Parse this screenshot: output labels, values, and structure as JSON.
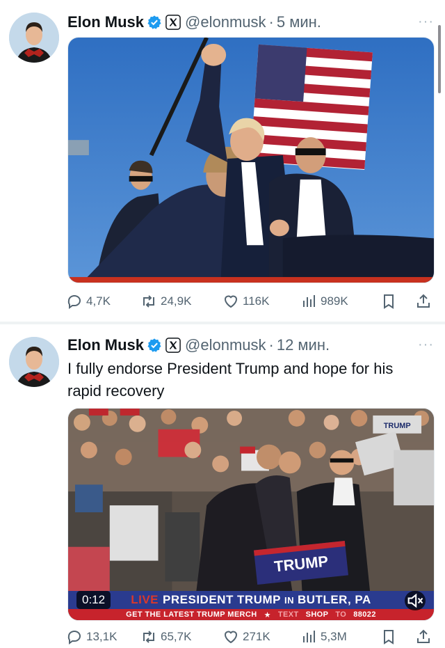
{
  "tweets": [
    {
      "name": "Elon Musk",
      "handle": "@elonmusk",
      "separator": "·",
      "time": "5 мин.",
      "more": "···",
      "text": "",
      "stats": {
        "replies": "4,7K",
        "reposts": "24,9K",
        "likes": "116K",
        "views": "989K"
      }
    },
    {
      "name": "Elon Musk",
      "handle": "@elonmusk",
      "separator": "·",
      "time": "12 мин.",
      "more": "···",
      "text": "I fully endorse President Trump and hope for his rapid recovery",
      "video": {
        "duration": "0:12",
        "ticker_live": "LIVE",
        "ticker_main": "PRESIDENT TRUMP",
        "ticker_in": "IN",
        "ticker_place": "BUTLER, PA",
        "merch_left": "GET THE LATEST TRUMP MERCH",
        "merch_star": "★",
        "merch_text": "TEXT",
        "merch_shop": "SHOP",
        "merch_to": "TO",
        "merch_number": "88022",
        "sign_text": "TRUMP"
      },
      "stats": {
        "replies": "13,1K",
        "reposts": "65,7K",
        "likes": "271K",
        "views": "5,3M"
      }
    }
  ],
  "colors": {
    "verified": "#1d9bf0",
    "text_secondary": "#536471",
    "separator": "#eff3f4"
  },
  "icons": [
    "verified-badge-icon",
    "x-logo-icon",
    "reply-icon",
    "repost-icon",
    "like-icon",
    "views-icon",
    "bookmark-icon",
    "share-icon",
    "mute-icon"
  ]
}
